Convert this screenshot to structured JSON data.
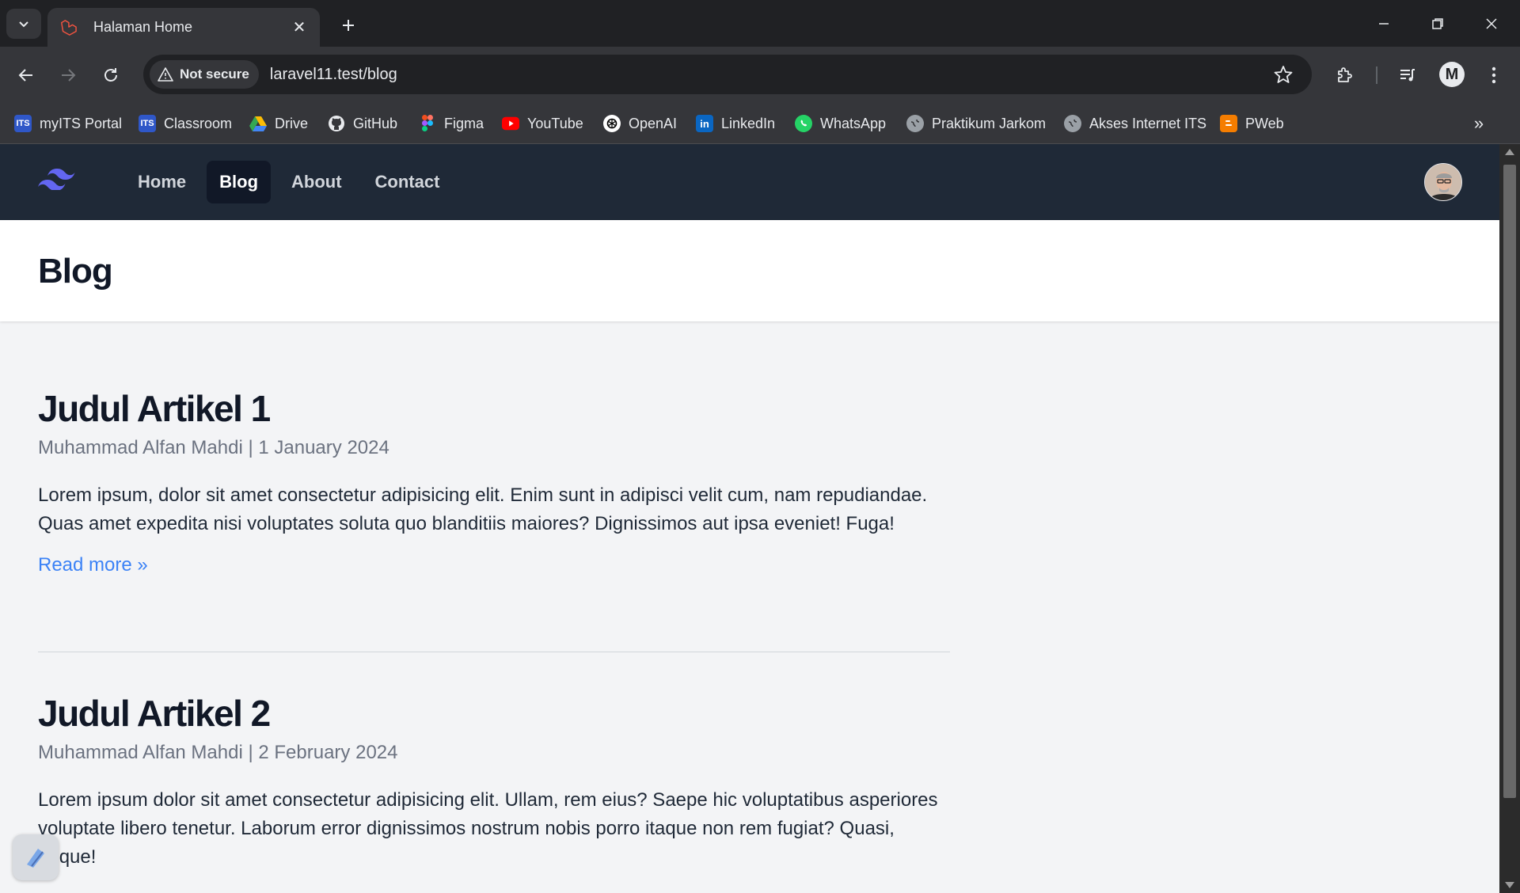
{
  "browser": {
    "tab": {
      "title": "Halaman Home",
      "favicon": "laravel-icon"
    },
    "omnibox": {
      "security_label": "Not secure",
      "url": "laravel11.test/blog"
    },
    "profile_initial": "M",
    "bookmarks": [
      {
        "label": "myITS Portal",
        "icon": "its-icon"
      },
      {
        "label": "Classroom",
        "icon": "its-icon"
      },
      {
        "label": "Drive",
        "icon": "drive-icon"
      },
      {
        "label": "GitHub",
        "icon": "github-icon"
      },
      {
        "label": "Figma",
        "icon": "figma-icon"
      },
      {
        "label": "YouTube",
        "icon": "youtube-icon"
      },
      {
        "label": "OpenAI",
        "icon": "openai-icon"
      },
      {
        "label": "LinkedIn",
        "icon": "linkedin-icon"
      },
      {
        "label": "WhatsApp",
        "icon": "whatsapp-icon"
      },
      {
        "label": "Praktikum Jarkom",
        "icon": "globe-icon"
      },
      {
        "label": "Akses Internet ITS",
        "icon": "globe-icon"
      },
      {
        "label": "PWeb",
        "icon": "blogger-icon"
      }
    ]
  },
  "site": {
    "nav": {
      "links": [
        {
          "label": "Home",
          "active": false
        },
        {
          "label": "Blog",
          "active": true
        },
        {
          "label": "About",
          "active": false
        },
        {
          "label": "Contact",
          "active": false
        }
      ]
    },
    "header": {
      "title": "Blog"
    },
    "articles": [
      {
        "title": "Judul Artikel 1",
        "author": "Muhammad Alfan Mahdi",
        "separator": "|",
        "date": "1 January 2024",
        "body": "Lorem ipsum, dolor sit amet consectetur adipisicing elit. Enim sunt in adipisci velit cum, nam repudiandae. Quas amet expedita nisi voluptates soluta quo blanditiis maiores? Dignissimos aut ipsa eveniet! Fuga!",
        "read_more": "Read more »"
      },
      {
        "title": "Judul Artikel 2",
        "author": "Muhammad Alfan Mahdi",
        "separator": "|",
        "date": "2 February 2024",
        "body": "Lorem ipsum dolor sit amet consectetur adipisicing elit. Ullam, rem eius? Saepe hic voluptatibus asperiores voluptate libero tenetur. Laborum error dignissimos nostrum nobis porro itaque non rem fugiat? Quasi, neque!"
      }
    ]
  },
  "colors": {
    "nav_bg": "#1f2937",
    "nav_active_bg": "#111827",
    "page_bg": "#f3f4f6",
    "link": "#3b82f6",
    "logo": "#6366f1"
  }
}
